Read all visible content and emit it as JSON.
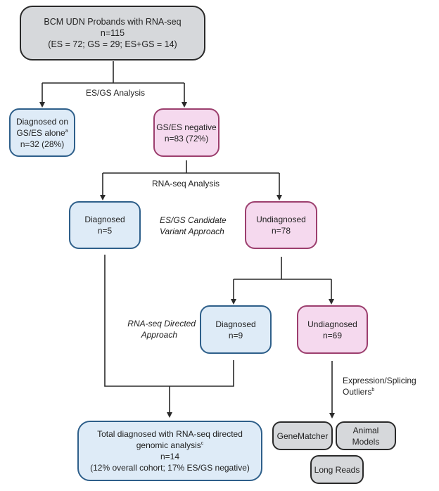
{
  "root": {
    "title": "BCM UDN Probands with RNA-seq",
    "count": "n=115",
    "breakdown": "(ES = 72; GS = 29; ES+GS = 14)"
  },
  "step1_label": "ES/GS Analysis",
  "diagnosed_esgs": {
    "line1": "Diagnosed on",
    "line2": "GS/ES alone",
    "footnote": "a",
    "count": "n=32 (28%)"
  },
  "esgs_negative": {
    "title": "GS/ES negative",
    "count": "n=83 (72%)"
  },
  "step2_label": "RNA-seq Analysis",
  "candidate_approach": {
    "line1": "ES/GS Candidate",
    "line2": "Variant Approach"
  },
  "diagnosed_candidate": {
    "title": "Diagnosed",
    "count": "n=5"
  },
  "undiagnosed_candidate": {
    "title": "Undiagnosed",
    "count": "n=78"
  },
  "directed_approach": {
    "line1": "RNA-seq Directed",
    "line2": "Approach"
  },
  "diagnosed_directed": {
    "title": "Diagnosed",
    "count": "n=9"
  },
  "undiagnosed_directed": {
    "title": "Undiagnosed",
    "count": "n=69"
  },
  "outliers_label": {
    "line1": "Expression/Splicing",
    "line2": "Outliers",
    "footnote": "b"
  },
  "total": {
    "line1": "Total diagnosed with RNA-seq directed",
    "line2": "genomic analysis",
    "footnote": "c",
    "count": "n=14",
    "detail": "(12% overall cohort; 17% ES/GS negative)"
  },
  "followups": [
    {
      "line1": "GeneMatcher",
      "line2": ""
    },
    {
      "line1": "Animal",
      "line2": "Models"
    },
    {
      "line1": "Long Reads",
      "line2": ""
    }
  ],
  "colors": {
    "gray_fill": "#d6d8db",
    "blue_fill": "#deebf7",
    "blue_border": "#2e5f8a",
    "pink_fill": "#f5d9ee",
    "pink_border": "#9c3f6e",
    "line": "#2a2a2a"
  }
}
